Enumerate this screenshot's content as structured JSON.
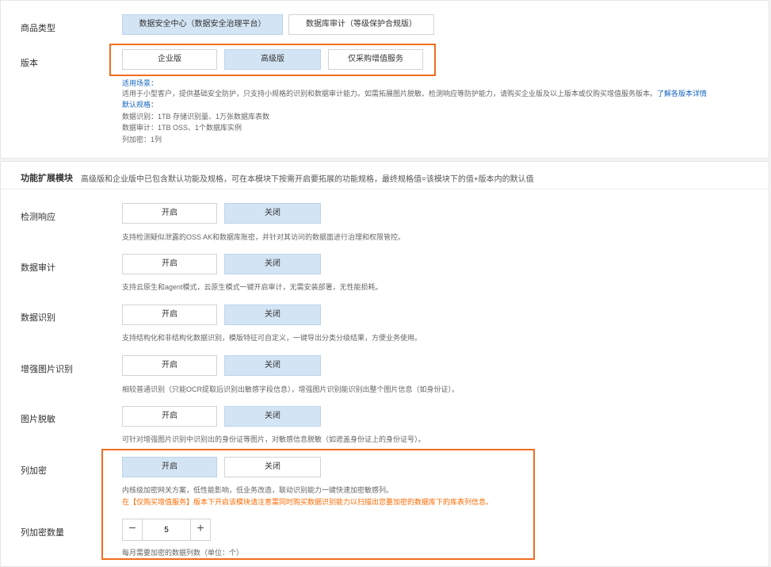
{
  "product": {
    "type_label": "商品类型",
    "type_options": [
      "数据安全中心（数据安全治理平台）",
      "数据库审计（等级保护合规版）"
    ],
    "edition_label": "版本",
    "edition_options": [
      "企业版",
      "高级版",
      "仅采购增值服务"
    ],
    "edition_selected": "高级版",
    "scenario_title": "适用场景：",
    "scenario_text": "适用于小型客户，提供基础安全防护，只支持小规格的识别和数据审计能力。如需拓展图片脱敏、检测响应等防护能力，请购买企业版及以上版本或仅购买增值服务版本。",
    "scenario_link": "了解各版本详情",
    "spec_title": "默认规格：",
    "spec_lines": [
      "数据识别：1TB 存储识别量、1万张数据库表数",
      "数据审计：1TB OSS、1个数据库实例",
      "列加密：1列"
    ]
  },
  "extension": {
    "title": "功能扩展模块",
    "note": "高级版和企业版中已包含默认功能及规格，可在本模块下按需开启要拓展的功能规格，最终规格值=该模块下的值+版本内的默认值",
    "on_label": "开启",
    "off_label": "关闭",
    "modules": [
      {
        "label": "检测响应",
        "state": "关闭",
        "desc": "支持检测疑似泄露的OSS AK和数据库账密，并针对其访问的数据面进行治理和权限管控。"
      },
      {
        "label": "数据审计",
        "state": "关闭",
        "desc": "支持云原生和agent模式，云原生模式一键开启审计，无需安装部署，无性能损耗。"
      },
      {
        "label": "数据识别",
        "state": "关闭",
        "desc": "支持结构化和非结构化数据识别，模版特征可自定义，一键导出分类分级结果，方便业务使用。"
      },
      {
        "label": "增强图片识别",
        "state": "关闭",
        "desc": "相较普通识别（只能OCR提取后识别出敏感字段信息），增强图片识别能识别出整个图片信息（如身份证）。"
      },
      {
        "label": "图片脱敏",
        "state": "关闭",
        "desc": "可针对增强图片识别中识别出的身份证等图片，对敏感信息脱敏（如遮盖身份证上的身份证号）。"
      }
    ],
    "column_encryption": {
      "label": "列加密",
      "state": "开启",
      "desc": "内核级加密网关方案，低性能影响，低业务改造，联动识别能力一键快速加密敏感列。",
      "warning": "在【仅购买增值服务】版本下开启该模块请注意需同时购买数据识别能力以扫描出您要加密的数据库下的库表列信息。"
    },
    "column_count": {
      "label": "列加密数量",
      "value": "5",
      "minus": "−",
      "plus": "+",
      "hint": "每月需要加密的数据列数（单位：个）"
    }
  },
  "colors": {
    "selected_bg": "#d3e4f4",
    "link": "#1464be",
    "highlight_border": "#f26d1f",
    "warning": "#ff6a00"
  }
}
